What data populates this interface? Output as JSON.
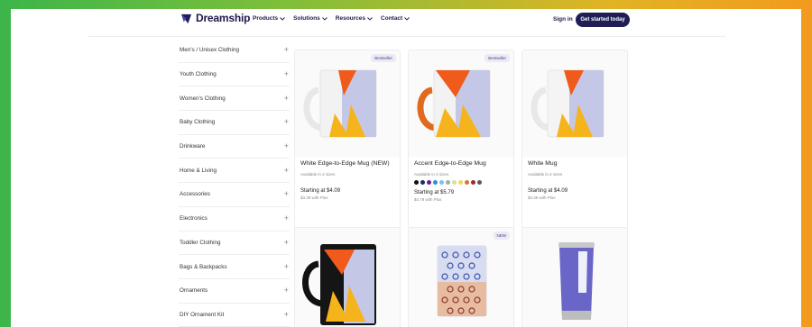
{
  "header": {
    "brand": "Dreamship",
    "nav": [
      "Products",
      "Solutions",
      "Resources",
      "Contact"
    ],
    "signin": "Sign in",
    "cta": "Get started today"
  },
  "sidebar": {
    "items": [
      {
        "label": "Men's / Unisex Clothing"
      },
      {
        "label": "Youth Clothing"
      },
      {
        "label": "Women's Clothing"
      },
      {
        "label": "Baby Clothing"
      },
      {
        "label": "Drinkware"
      },
      {
        "label": "Home & Living"
      },
      {
        "label": "Accessories"
      },
      {
        "label": "Electronics"
      },
      {
        "label": "Toddler Clothing"
      },
      {
        "label": "Bags & Backpacks"
      },
      {
        "label": "Ornaments"
      },
      {
        "label": "DIY Ornament Kit"
      }
    ],
    "expand_symbol": "+"
  },
  "products": [
    {
      "title": "White Edge-to-Edge Mug (NEW)",
      "badge": "Bestseller",
      "sub": "Available in 2 sizes",
      "price": "Starting at $4.09",
      "plus": "$3.39 with Plus",
      "style": "white-mug"
    },
    {
      "title": "Accent Edge-to-Edge Mug",
      "badge": "Bestseller",
      "sub": "Available in 2 sizes",
      "price": "Starting at $5.79",
      "plus": "$4.79 with Plus",
      "style": "accent-mug",
      "swatches": [
        "#111111",
        "#1b2a6b",
        "#6b1f8f",
        "#2b8fd6",
        "#7cc2e8",
        "#9bb0a6",
        "#cfe39a",
        "#f0d46a",
        "#d8742e",
        "#9c2b2b",
        "#5a5a5a"
      ]
    },
    {
      "title": "White Mug",
      "badge": "",
      "sub": "Available in 2 sizes",
      "price": "Starting at $4.09",
      "plus": "$3.39 with Plus",
      "style": "white-mug"
    },
    {
      "title": "",
      "badge": "",
      "style": "black-mug"
    },
    {
      "title": "",
      "badge": "NEW",
      "style": "glass"
    },
    {
      "title": "",
      "badge": "",
      "style": "tumbler"
    }
  ],
  "colors": {
    "brand_navy": "#1f1c56",
    "orange": "#f26a1b",
    "yellow": "#f5b41b",
    "lavender": "#c3c6e6"
  }
}
